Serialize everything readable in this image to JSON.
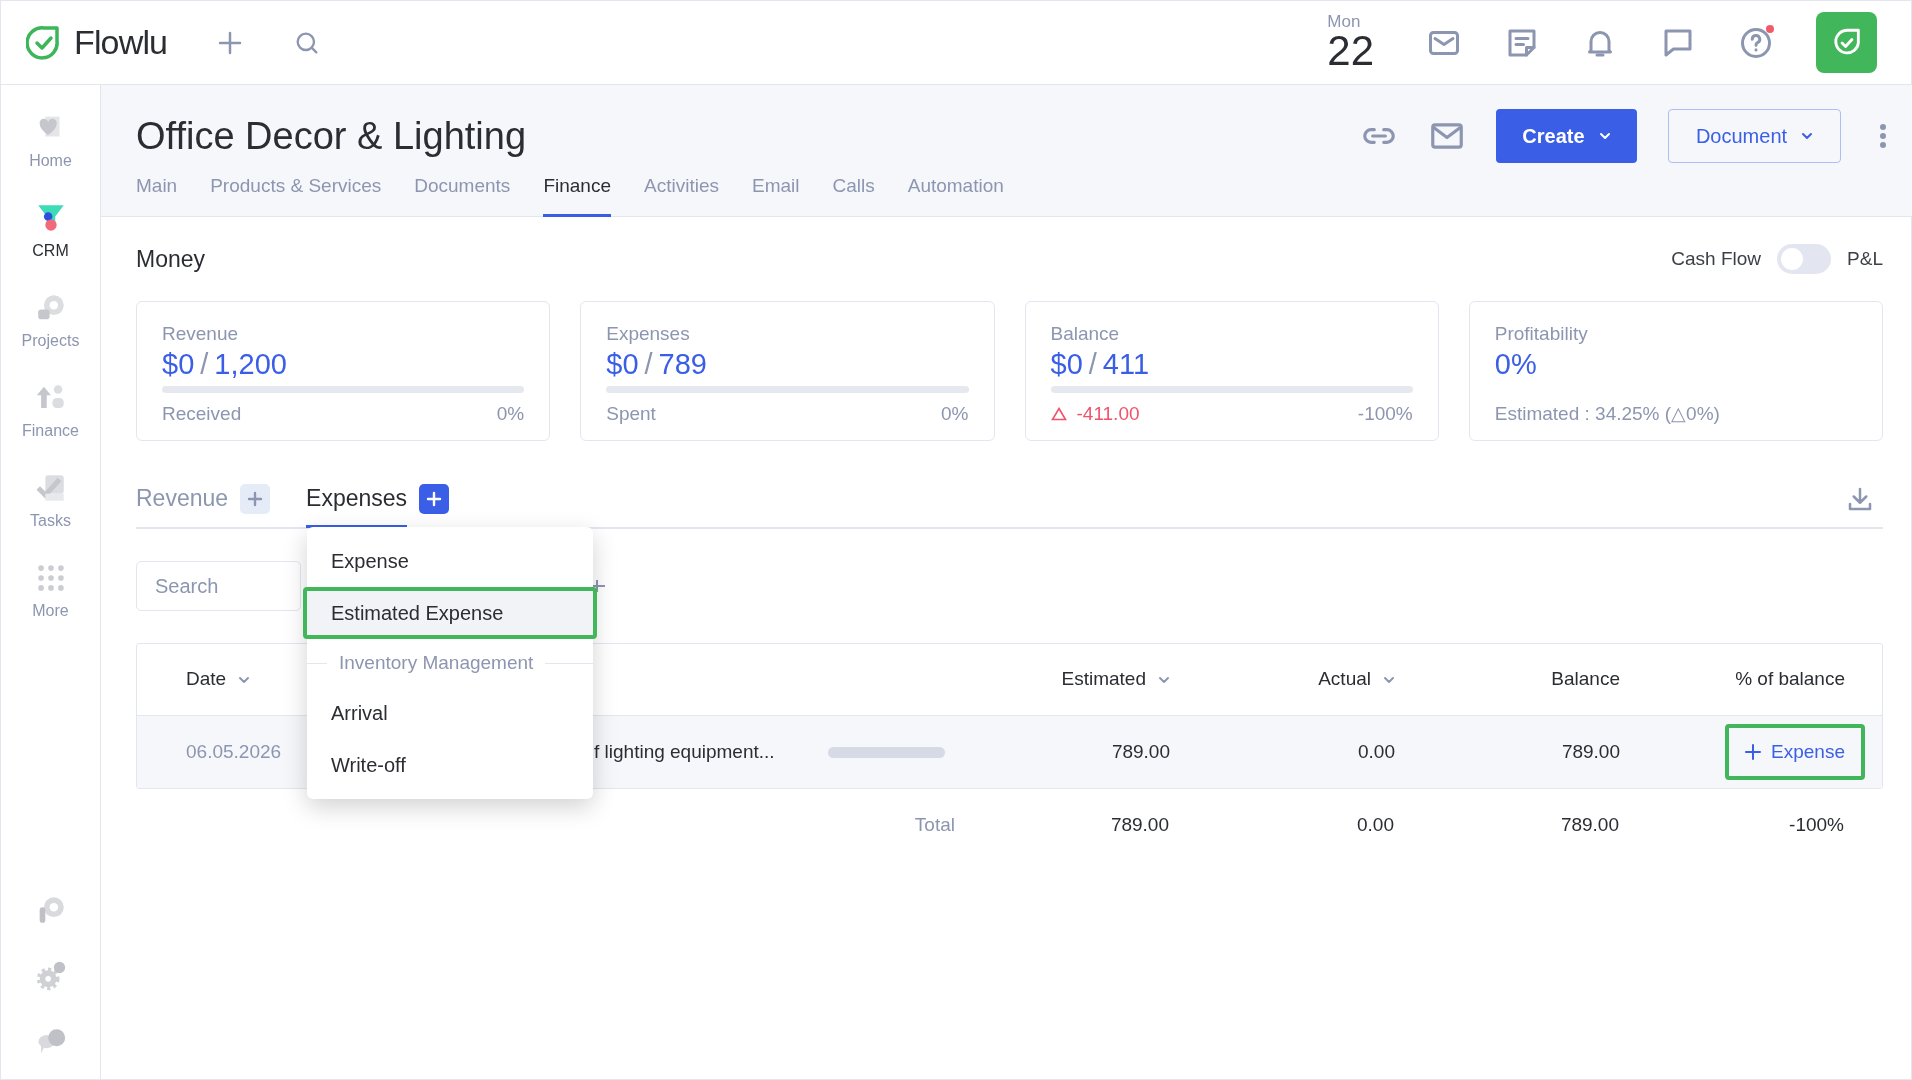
{
  "topbar": {
    "logo": "Flowlu",
    "date": {
      "weekday": "Mon",
      "day": "22"
    },
    "help_notification": true
  },
  "sidebar": {
    "items": [
      {
        "kind": "home",
        "label": "Home",
        "selected": false
      },
      {
        "kind": "crm",
        "label": "CRM",
        "selected": true
      },
      {
        "kind": "projects",
        "label": "Projects",
        "selected": false
      },
      {
        "kind": "finance",
        "label": "Finance",
        "selected": false
      },
      {
        "kind": "tasks",
        "label": "Tasks",
        "selected": false
      },
      {
        "kind": "more",
        "label": "More",
        "selected": false
      }
    ]
  },
  "header": {
    "title": "Office Decor & Lighting",
    "create_button": "Create",
    "document_button": "Document",
    "tabs": [
      {
        "label": "Main",
        "selected": false
      },
      {
        "label": "Products & Services",
        "selected": false
      },
      {
        "label": "Documents",
        "selected": false
      },
      {
        "label": "Finance",
        "selected": true
      },
      {
        "label": "Activities",
        "selected": false
      },
      {
        "label": "Email",
        "selected": false
      },
      {
        "label": "Calls",
        "selected": false
      },
      {
        "label": "Automation",
        "selected": false
      }
    ]
  },
  "money": {
    "title": "Money",
    "toggle": {
      "left_label": "Cash Flow",
      "right_label": "P&L",
      "on": false
    },
    "cards": [
      {
        "kind": "progress",
        "label": "Revenue",
        "paid": "$0",
        "separator": "/",
        "total": "1,200",
        "level": 0,
        "footer": "Received",
        "percent": "0%"
      },
      {
        "kind": "progress",
        "label": "Expenses",
        "paid": "$0",
        "separator": "/",
        "total": "789",
        "level": 0,
        "footer": "Spent",
        "percent": "0%"
      },
      {
        "kind": "progress",
        "label": "Balance",
        "paid": "$0",
        "separator": "/",
        "total": "411",
        "level": 0,
        "delta": "-411.00",
        "percent": "-100%"
      },
      {
        "kind": "estimate",
        "label": "Profitability",
        "value": "0%",
        "footer": "Estimated : 34.25% (△0%)"
      }
    ]
  },
  "ledger": {
    "tabs": [
      {
        "label": "Revenue",
        "selected": false
      },
      {
        "label": "Expenses",
        "selected": true
      }
    ],
    "search": {
      "placeholder": "Search"
    },
    "menu": [
      {
        "kind": "item",
        "label": "Expense",
        "highlighted": false
      },
      {
        "kind": "item",
        "label": "Estimated Expense",
        "highlighted": true
      },
      {
        "kind": "section",
        "label": "Inventory Management"
      },
      {
        "kind": "item",
        "label": "Arrival",
        "highlighted": false
      },
      {
        "kind": "item",
        "label": "Write-off",
        "highlighted": false
      }
    ],
    "table": {
      "columns": [
        {
          "label": "Date",
          "sortable": true
        },
        {
          "label": "Estimated",
          "sortable": true
        },
        {
          "label": "Actual",
          "sortable": true
        },
        {
          "label": "Balance",
          "sortable": false
        },
        {
          "label": "% of balance",
          "sortable": false
        }
      ],
      "rows": [
        {
          "date": "06.05.2026",
          "name": "f lighting equipment...",
          "level": 0,
          "estimated": "789.00",
          "actual": "0.00",
          "balance": "789.00",
          "action": "Expense",
          "action_highlighted": true
        }
      ],
      "total": {
        "label": "Total",
        "estimated": "789.00",
        "actual": "0.00",
        "balance": "789.00",
        "percent": "-100%"
      }
    }
  }
}
